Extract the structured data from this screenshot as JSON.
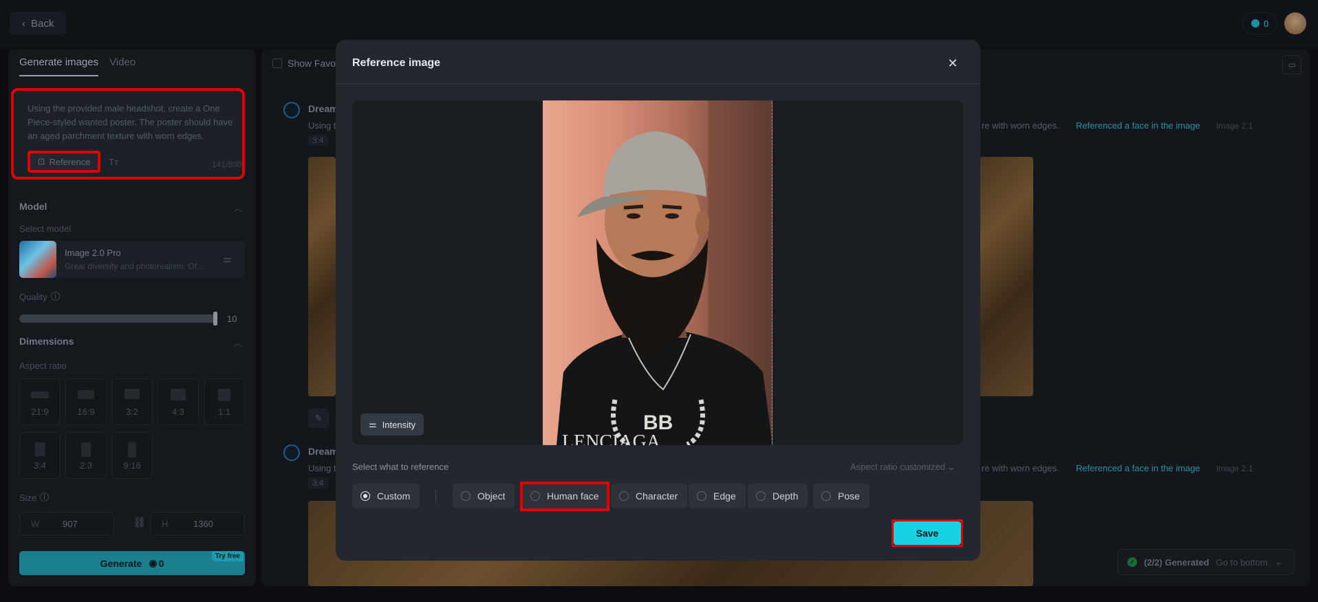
{
  "topbar": {
    "back_label": "Back",
    "credits": "0"
  },
  "left_panel": {
    "tabs": [
      "Generate images",
      "Video"
    ],
    "prompt": "Using the provided male headshot, create a One Piece-styled wanted poster. The poster should have an aged parchment texture with worn edges.",
    "reference_label": "Reference",
    "char_count": "141/800",
    "model_section": "Model",
    "select_model_label": "Select model",
    "model_name": "Image 2.0 Pro",
    "model_desc": "Great diversity and photorealism. Of...",
    "quality_label": "Quality",
    "quality_value": "10",
    "quality_fraction": 1.0,
    "dimensions_section": "Dimensions",
    "aspect_label": "Aspect ratio",
    "ratios": [
      "21:9",
      "16:9",
      "3:2",
      "4:3",
      "1:1",
      "3:4",
      "2:3",
      "9:16"
    ],
    "size_label": "Size",
    "width_key": "W",
    "width_value": "907",
    "height_key": "H",
    "height_value": "1360",
    "generate_label": "Generate",
    "generate_cost": "0",
    "try_free": "Try free"
  },
  "main": {
    "show_favorites": "Show Favor",
    "entries": [
      {
        "name": "Dream",
        "prompt_start": "Using t",
        "prompt_tail": "re with worn edges.",
        "ref_link": "Referenced a face in the image",
        "model_tag": "Image 2.1",
        "aspect": "3:4"
      },
      {
        "name": "Dream",
        "prompt_start": "Using t",
        "prompt_tail": "re with worn edges.",
        "ref_link": "Referenced a face in the image",
        "model_tag": "Image 2.1",
        "aspect": "3:4"
      }
    ],
    "toast_status": "(2/2) Generated",
    "toast_action": "Go to bottom"
  },
  "modal": {
    "title": "Reference image",
    "intensity_label": "Intensity",
    "select_label": "Select what to reference",
    "aspect_customized": "Aspect ratio customized",
    "options": [
      {
        "label": "Custom",
        "selected": true
      },
      {
        "label": "Object",
        "selected": false
      },
      {
        "label": "Human face",
        "selected": false
      },
      {
        "label": "Character",
        "selected": false
      },
      {
        "label": "Edge",
        "selected": false
      },
      {
        "label": "Depth",
        "selected": false
      },
      {
        "label": "Pose",
        "selected": false
      }
    ],
    "save_label": "Save",
    "shirt_text": "BB",
    "shirt_brand": "LENCIAGA"
  },
  "colors": {
    "accent": "#16d2e4",
    "highlight": "#e00000",
    "modal_bg": "#23272e"
  }
}
